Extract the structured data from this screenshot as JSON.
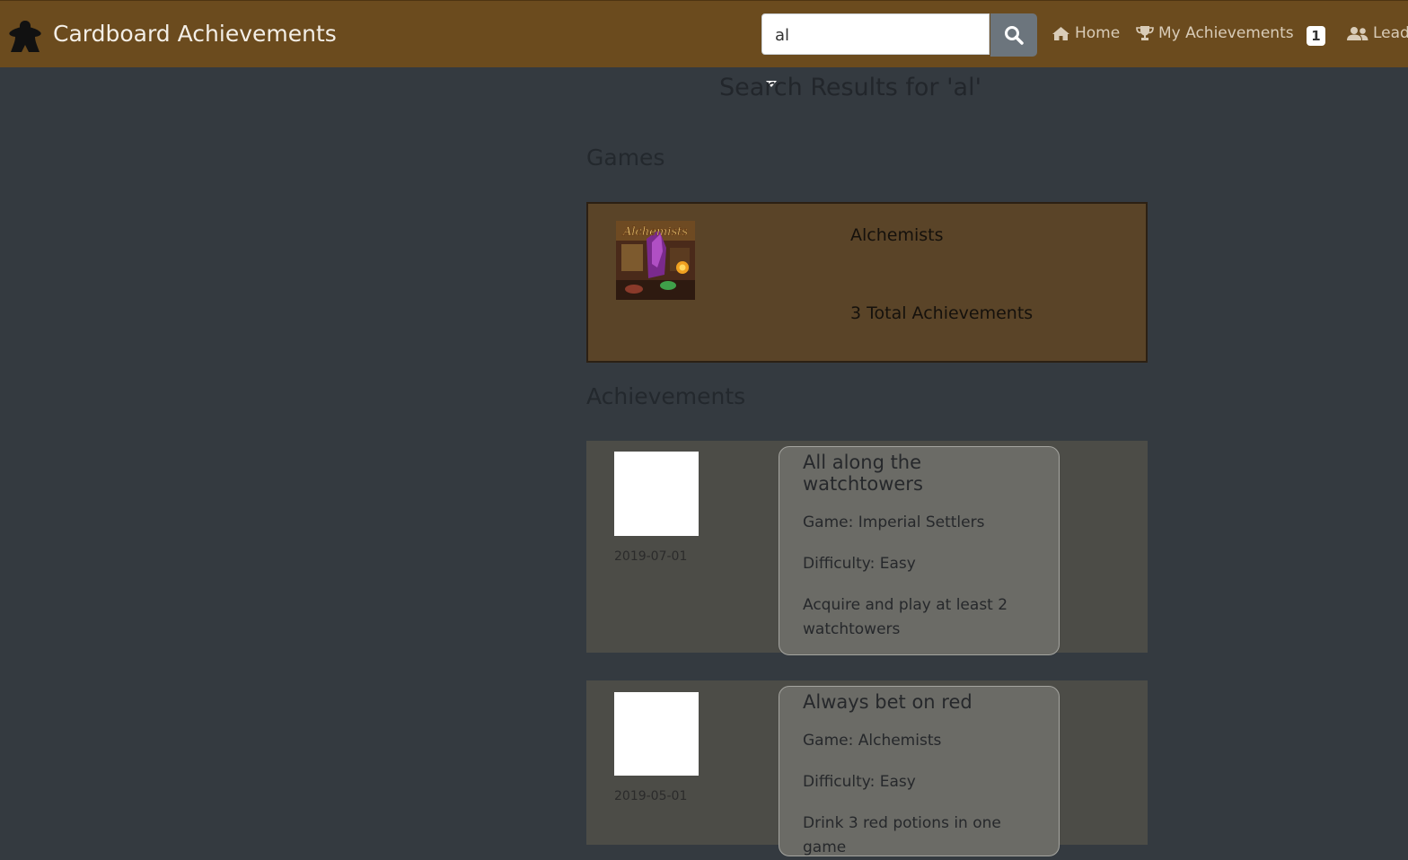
{
  "navbar": {
    "brand": "Cardboard Achievements",
    "search_value": "al",
    "links": {
      "home": "Home",
      "my_achievements": "My Achievements",
      "notification_count": "1",
      "leaderboard": "Lead"
    },
    "colors": {
      "bar": "#6b4b1e"
    }
  },
  "page": {
    "title": "Search Results for 'al'",
    "games_heading": "Games",
    "achievements_heading": "Achievements"
  },
  "games": [
    {
      "name": "Alchemists",
      "total": "3 Total Achievements",
      "box_art_title": "Alchemists"
    }
  ],
  "achievements": [
    {
      "title": "All along the watchtowers",
      "game": "Game: Imperial Settlers",
      "difficulty": "Difficulty: Easy",
      "description": "Acquire and play at least 2 watchtowers",
      "date": "2019-07-01"
    },
    {
      "title": "Always bet on red",
      "game": "Game: Alchemists",
      "difficulty": "Difficulty: Easy",
      "description": "Drink 3 red potions in one game",
      "date": "2019-05-01"
    }
  ]
}
